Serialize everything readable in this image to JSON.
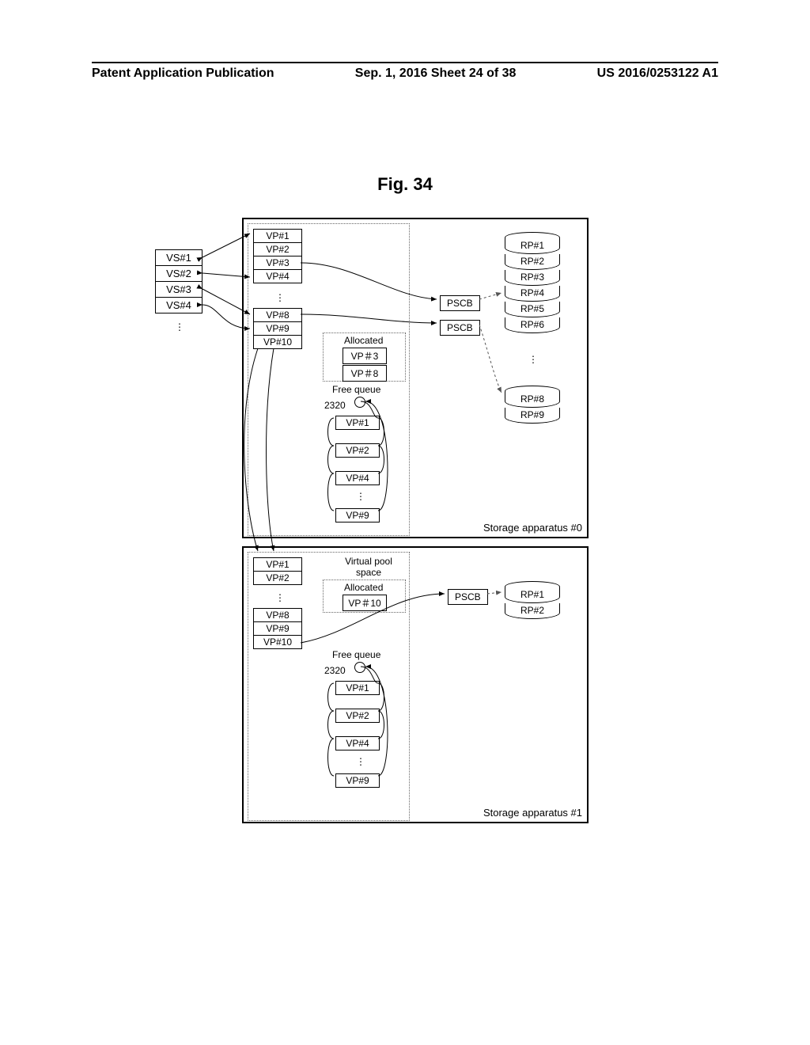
{
  "header": {
    "left": "Patent Application Publication",
    "center": "Sep. 1, 2016  Sheet 24 of 38",
    "right": "US 2016/0253122 A1"
  },
  "figure_title": "Fig. 34",
  "vs_list": [
    "VS#1",
    "VS#2",
    "VS#3",
    "VS#4"
  ],
  "apparatus0": {
    "label": "Storage apparatus #0",
    "vp_col": [
      "VP#1",
      "VP#2",
      "VP#3",
      "VP#4",
      "VP#8",
      "VP#9",
      "VP#10"
    ],
    "allocated_label": "Allocated",
    "allocated": [
      "VP＃3",
      "VP＃8"
    ],
    "free_queue_label": "Free queue",
    "free_queue": [
      "VP#1",
      "VP#2",
      "VP#4",
      "VP#9"
    ],
    "ref_2320": "2320",
    "pscb": [
      "PSCB",
      "PSCB"
    ],
    "rp_list": [
      "RP#1",
      "RP#2",
      "RP#3",
      "RP#4",
      "RP#5",
      "RP#6",
      "RP#8",
      "RP#9"
    ]
  },
  "apparatus1": {
    "label": "Storage apparatus #1",
    "virtual_pool_label": "Virtual pool space",
    "vp_col": [
      "VP#1",
      "VP#2",
      "VP#8",
      "VP#9",
      "VP#10"
    ],
    "allocated_label": "Allocated",
    "allocated": [
      "VP＃10"
    ],
    "free_queue_label": "Free queue",
    "free_queue": [
      "VP#1",
      "VP#2",
      "VP#4",
      "VP#9"
    ],
    "ref_2320": "2320",
    "pscb": [
      "PSCB"
    ],
    "rp_list": [
      "RP#1",
      "RP#2"
    ]
  }
}
